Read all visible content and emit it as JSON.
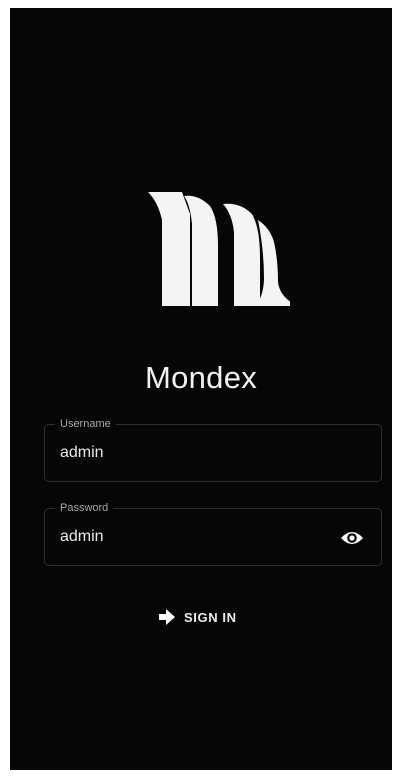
{
  "app": {
    "title": "Mondex",
    "logo_icon": "mondex-m-logo-icon"
  },
  "form": {
    "username": {
      "label": "Username",
      "value": "admin"
    },
    "password": {
      "label": "Password",
      "value": "admin",
      "toggle_icon": "eye-icon"
    },
    "signin": {
      "label": "SIGN IN",
      "icon": "arrow-right-icon"
    }
  },
  "colors": {
    "background": "#060606",
    "text": "#f2f2f2",
    "outline": "#2f2f2f",
    "label": "#a9a9a9"
  }
}
